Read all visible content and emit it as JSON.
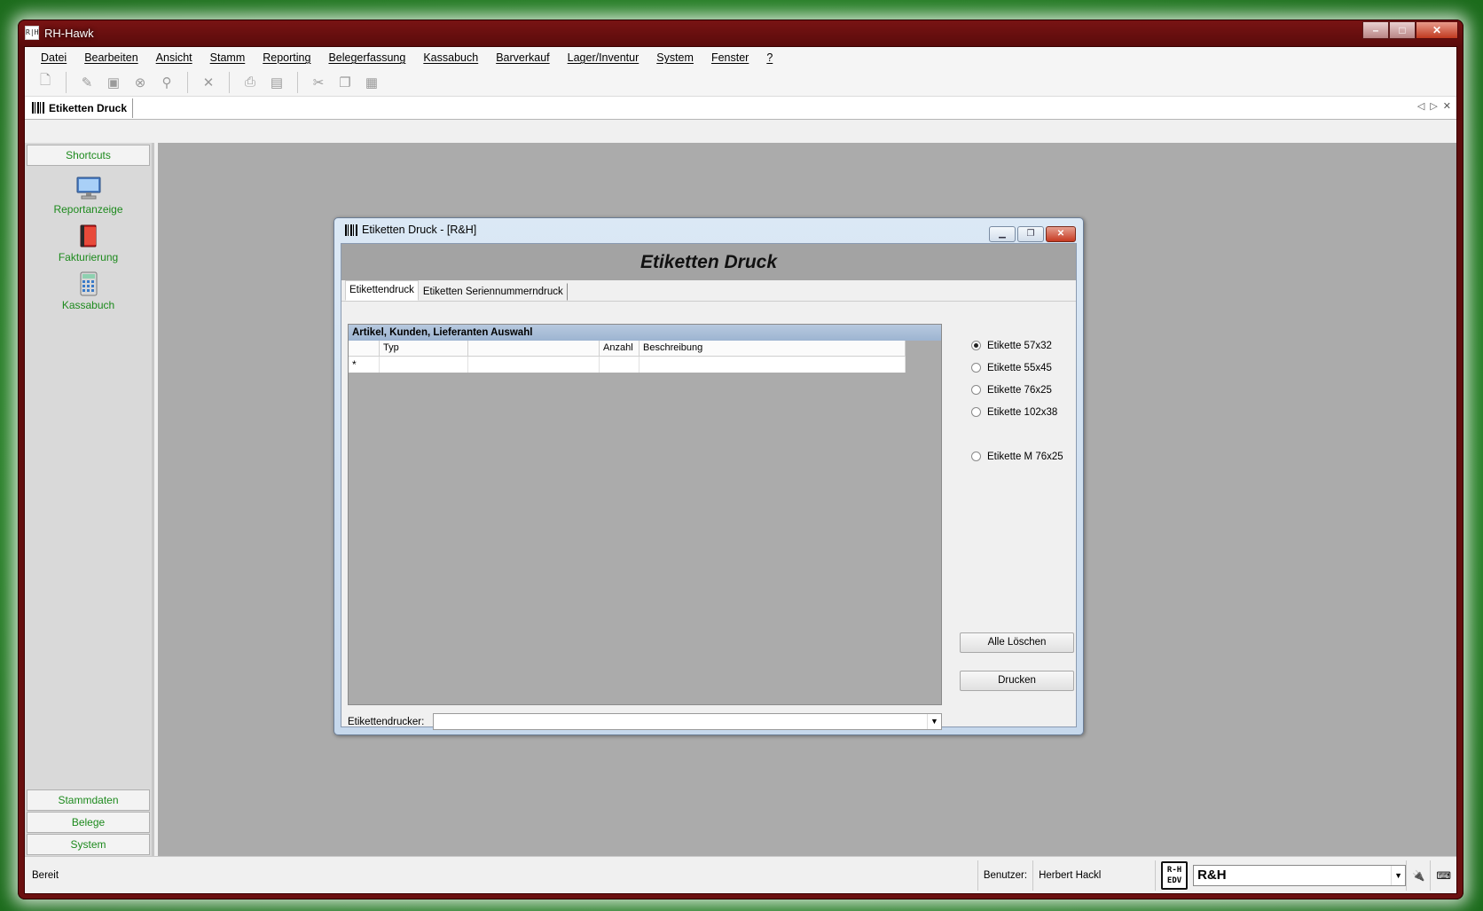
{
  "app": {
    "title": "RH-Hawk",
    "icon_text": "R|H"
  },
  "menu": [
    "Datei",
    "Bearbeiten",
    "Ansicht",
    "Stamm",
    "Reporting",
    "Belegerfassung",
    "Kassabuch",
    "Barverkauf",
    "Lager/Inventur",
    "System",
    "Fenster",
    "?"
  ],
  "toolbar_icons": [
    "new-doc-icon",
    "edit-icon",
    "save-icon",
    "cancel-icon",
    "search-icon",
    "delete-icon",
    "print-icon",
    "print-preview-icon",
    "cut-icon",
    "copy-icon",
    "paste-icon"
  ],
  "document_tab": {
    "label": "Etiketten Druck"
  },
  "sidebar": {
    "header": "Shortcuts",
    "shortcuts": [
      {
        "label": "Reportanzeige",
        "icon": "monitor-icon"
      },
      {
        "label": "Fakturierung",
        "icon": "book-icon"
      },
      {
        "label": "Kassabuch",
        "icon": "calculator-icon"
      }
    ],
    "groups": [
      "Stammdaten",
      "Belege",
      "System"
    ]
  },
  "status": {
    "text": "Bereit",
    "user_label": "Benutzer:",
    "user_name": "Herbert Hackl",
    "logo_text": "R-H EDV",
    "company": "R&H"
  },
  "child_window": {
    "title": "Etiketten Druck - [R&H]",
    "header": "Etiketten Druck",
    "tabs": [
      "Etikettendruck",
      "Etiketten Seriennummerndruck"
    ],
    "grid": {
      "caption": "Artikel, Kunden, Lieferanten Auswahl",
      "columns": [
        "",
        "Typ",
        "",
        "Anzahl",
        "Beschreibung"
      ],
      "new_row_marker": "*"
    },
    "label_options": [
      {
        "label": "Etikette 57x32",
        "checked": true
      },
      {
        "label": "Etikette 55x45",
        "checked": false
      },
      {
        "label": "Etikette 76x25",
        "checked": false
      },
      {
        "label": "Etikette 102x38",
        "checked": false
      },
      {
        "label": "Etikette M 76x25",
        "checked": false
      }
    ],
    "buttons": {
      "clear_all": "Alle Löschen",
      "print": "Drucken"
    },
    "printer_label": "Etikettendrucker:",
    "printer_value": ""
  }
}
